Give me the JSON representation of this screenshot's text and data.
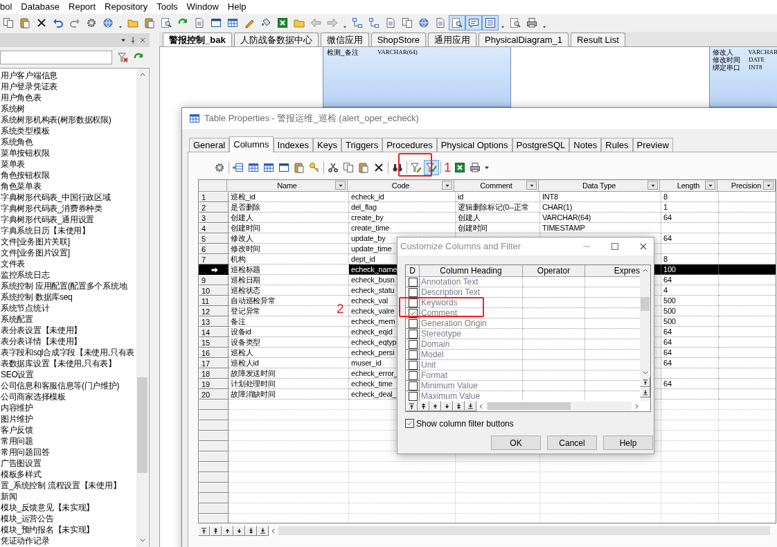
{
  "menu_bar": [
    "bol",
    "Database",
    "Report",
    "Repository",
    "Tools",
    "Window",
    "Help"
  ],
  "doc_tabs": [
    {
      "label": "警报控制_bak",
      "selected": true
    },
    {
      "label": "人防战备数据中心",
      "selected": false
    },
    {
      "label": "微信应用",
      "selected": false
    },
    {
      "label": "ShopStore",
      "selected": false
    },
    {
      "label": "通用应用",
      "selected": false
    },
    {
      "label": "PhysicalDiagram_1",
      "selected": false
    },
    {
      "label": "Result List",
      "selected": false
    }
  ],
  "browser": {
    "items": [
      "用户客户端信息",
      "用户登录凭证表",
      "用户角色表",
      "系统树",
      "系统树形机构表(树形数据权限)",
      "系统类型模板",
      "系统角色",
      "菜单按钮权限",
      "菜单表",
      "角色按钮权限",
      "角色菜单表",
      "字典树形代码表_中国行政区域",
      "字典树形代码表_消费券种类",
      "字典树形代码表_通用设置",
      "字典系统日历【未使用】",
      "文件[业务图片关联]",
      "文件[业务图片设置]",
      "文件表",
      "监控系统日志",
      "系统控制 应用配置(配置多个系统地",
      "系统控制 数据库seq",
      "系统节点统计",
      "系统配置",
      "表分表设置【未使用】",
      "表分表详情【未使用】",
      "表字段和sql合成字段【未使用,只有表",
      "表数据库设置【未使用,只有表】",
      "SEO设置",
      "公司信息和客服信息等(门户维护)",
      "公司商家选择模板",
      "内容维护",
      "图片维护",
      "客户反馈",
      "常用问题",
      "常用问题回答",
      "广告图设置",
      "模板多样式",
      "置_系统控制 流程设置【未使用】",
      "新闻",
      "模块_反馈意见【未实现】",
      "模块_运营公告",
      "模块_预约报名【未实现】",
      "凭证动作记录"
    ]
  },
  "diagram": {
    "entities": [
      {
        "rows": [
          {
            "name": "检测_备注",
            "type": "VARCHAR(64)"
          }
        ]
      },
      {
        "rows": [
          {
            "name": "修改人",
            "type": "VARCHAR"
          },
          {
            "name": "修改时间",
            "type": "DATE"
          },
          {
            "name": "绑定串口",
            "type": "INT8"
          }
        ]
      }
    ]
  },
  "table_properties": {
    "title": "Table Properties - 警报运维_巡检 (alert_oper_echeck)",
    "tabs": [
      {
        "label": "General",
        "selected": false
      },
      {
        "label": "Columns",
        "selected": true
      },
      {
        "label": "Indexes",
        "selected": false
      },
      {
        "label": "Keys",
        "selected": false
      },
      {
        "label": "Triggers",
        "selected": false
      },
      {
        "label": "Procedures",
        "selected": false
      },
      {
        "label": "Physical Options",
        "selected": false
      },
      {
        "label": "PostgreSQL",
        "selected": false
      },
      {
        "label": "Notes",
        "selected": false
      },
      {
        "label": "Rules",
        "selected": false
      },
      {
        "label": "Preview",
        "selected": false
      }
    ],
    "columns": [
      "Name",
      "Code",
      "Comment",
      "Data Type",
      "Length",
      "Precision"
    ],
    "rows": [
      {
        "number": "1",
        "name": "巡检_id",
        "code": "echeck_id",
        "comment": "id",
        "data_type": "INT8",
        "length": "8",
        "selected": false
      },
      {
        "number": "2",
        "name": "是否删除",
        "code": "del_flag",
        "comment": "逻辑删除标记(0--正常",
        "data_type": "CHAR(1)",
        "length": "1",
        "selected": false
      },
      {
        "number": "3",
        "name": "创建人",
        "code": "create_by",
        "comment": "创建人",
        "data_type": "VARCHAR(64)",
        "length": "64",
        "selected": false
      },
      {
        "number": "4",
        "name": "创建时间",
        "code": "create_time",
        "comment": "创建时间",
        "data_type": "TIMESTAMP",
        "selected": false
      },
      {
        "number": "5",
        "name": "修改人",
        "code": "update_by",
        "length": "64",
        "selected": false
      },
      {
        "number": "6",
        "name": "修改时间",
        "code": "update_time",
        "selected": false
      },
      {
        "number": "7",
        "name": "机构",
        "code": "dept_id",
        "length": "8",
        "selected": false
      },
      {
        "name": "巡检标题",
        "code": "echeck_name",
        "length": "100",
        "selected": true
      },
      {
        "number": "9",
        "name": "巡检日期",
        "code": "echeck_busn",
        "length": "64",
        "selected": false
      },
      {
        "number": "10",
        "name": "巡检状态",
        "code": "echeck_statu",
        "length": "4",
        "selected": false
      },
      {
        "number": "11",
        "name": "自动巡检异常",
        "code": "echeck_val",
        "length": "500",
        "selected": false
      },
      {
        "number": "12",
        "name": "登记异常",
        "code": "echeck_valre",
        "length": "500",
        "selected": false
      },
      {
        "number": "13",
        "name": "备注",
        "code": "echeck_mem",
        "length": "500",
        "selected": false
      },
      {
        "number": "14",
        "name": "设备id",
        "code": "echeck_eqid",
        "length": "64",
        "selected": false
      },
      {
        "number": "15",
        "name": "设备类型",
        "code": "echeck_eqtyp",
        "length": "64",
        "selected": false
      },
      {
        "number": "16",
        "name": "巡检人",
        "code": "echeck_persi",
        "length": "64",
        "selected": false
      },
      {
        "number": "17",
        "name": "巡检人id",
        "code": "muser_id",
        "length": "64",
        "selected": false
      },
      {
        "number": "18",
        "name": "故障发送时间",
        "code": "echeck_error_",
        "selected": false
      },
      {
        "number": "19",
        "name": "计划处理时间",
        "code": "echeck_time",
        "length": "64",
        "selected": false
      },
      {
        "number": "20",
        "name": "故障消缺时间",
        "code": "echeck_deal_",
        "selected": false
      }
    ]
  },
  "dialog": {
    "title": "Customize Columns and Filter",
    "columns": [
      "D",
      "Column Heading",
      "Operator",
      "Expres"
    ],
    "rows": [
      {
        "label": "Annotation Text",
        "checked": false
      },
      {
        "label": "Description Text",
        "checked": false
      },
      {
        "label": "Keywords",
        "checked": false
      },
      {
        "label": "Comment",
        "checked": true
      },
      {
        "label": "Generation Origin",
        "checked": false
      },
      {
        "label": "Stereotype",
        "checked": false
      },
      {
        "label": "Domain",
        "checked": false
      },
      {
        "label": "Model",
        "checked": false
      },
      {
        "label": "Unit",
        "checked": false
      },
      {
        "label": "Format",
        "checked": false
      },
      {
        "label": "Minimum Value",
        "checked": false
      },
      {
        "label": "Maximum Value",
        "checked": false
      }
    ],
    "show_filter_buttons": {
      "label": "Show column filter buttons",
      "checked": true
    },
    "buttons": [
      "OK",
      "Cancel",
      "Help"
    ]
  },
  "annotations": [
    {
      "label": "1"
    },
    {
      "label": "2"
    }
  ]
}
